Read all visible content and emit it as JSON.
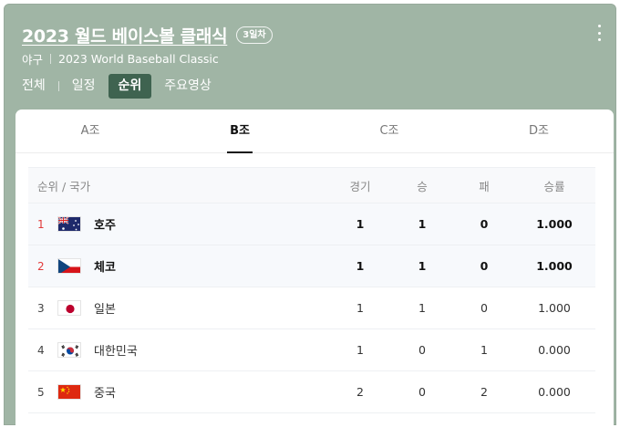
{
  "header": {
    "title": "2023 월드 베이스볼 클래식",
    "badge": "3일차",
    "category": "야구",
    "subtitle": "2023 World Baseball Classic"
  },
  "nav": {
    "items": [
      {
        "label": "전체"
      },
      {
        "label": "일정"
      },
      {
        "label": "순위"
      },
      {
        "label": "주요영상"
      }
    ],
    "active": "순위"
  },
  "groups": {
    "tabs": [
      {
        "label": "A조"
      },
      {
        "label": "B조"
      },
      {
        "label": "C조"
      },
      {
        "label": "D조"
      }
    ],
    "active": "B조"
  },
  "table": {
    "headers": {
      "team": "순위 / 국가",
      "games": "경기",
      "wins": "승",
      "losses": "패",
      "rate": "승률"
    },
    "rows": [
      {
        "rank": "1",
        "team": "호주",
        "flag": "australia-flag",
        "games": "1",
        "wins": "1",
        "losses": "0",
        "rate": "1.000"
      },
      {
        "rank": "2",
        "team": "체코",
        "flag": "czech-flag",
        "games": "1",
        "wins": "1",
        "losses": "0",
        "rate": "1.000"
      },
      {
        "rank": "3",
        "team": "일본",
        "flag": "japan-flag",
        "games": "1",
        "wins": "1",
        "losses": "0",
        "rate": "1.000"
      },
      {
        "rank": "4",
        "team": "대한민국",
        "flag": "korea-flag",
        "games": "1",
        "wins": "0",
        "losses": "1",
        "rate": "0.000"
      },
      {
        "rank": "5",
        "team": "중국",
        "flag": "china-flag",
        "games": "2",
        "wins": "0",
        "losses": "2",
        "rate": "0.000"
      }
    ]
  },
  "colors": {
    "header_bg": "#a0b5a5",
    "active_nav": "#3f6350",
    "rank_highlight": "#e23a3a"
  }
}
